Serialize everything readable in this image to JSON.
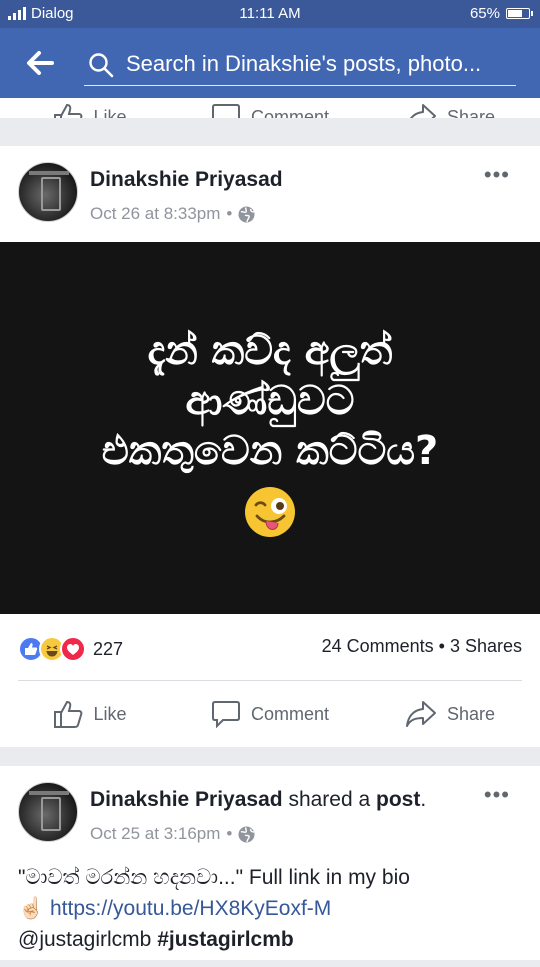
{
  "status_bar": {
    "carrier": "Dialog",
    "time": "11:11 AM",
    "battery": "65%",
    "battery_level": 0.65
  },
  "search": {
    "placeholder": "Search in Dinakshie's posts, photo..."
  },
  "prev_post": {
    "actions": [
      "Like",
      "Comment",
      "Share"
    ]
  },
  "post1": {
    "author": "Dinakshie Priyasad",
    "date": "Oct 26 at 8:33pm",
    "separator": "•",
    "more": "•••",
    "image_lines": [
      "දැන් කව්ද අලුත්",
      "ආණ්ඩුවට",
      "එකතුවෙන කට්ටිය?"
    ],
    "reactions_count": "227",
    "comments_shares": "24 Comments • 3 Shares",
    "actions": {
      "like": "Like",
      "comment": "Comment",
      "share": "Share"
    }
  },
  "post2": {
    "author": "Dinakshie Priyasad",
    "shared_text": " shared a ",
    "post_word": "post",
    "period": ".",
    "date": "Oct 25 at 3:16pm",
    "separator": "•",
    "more": "•••",
    "text_line1": "\"මාවත් මරන්න හදනවා...\" Full link in my bio",
    "text_glyphs": "☝🏻 ",
    "link": "https://youtu.be/HX8KyEoxf-M",
    "mention": "@justagirlcmb ",
    "hashtag": "#justagirlcmb"
  },
  "colors": {
    "status_bg": "#3b5998",
    "header_bg": "#4267b2",
    "link": "#365899",
    "meta": "#90949c"
  }
}
